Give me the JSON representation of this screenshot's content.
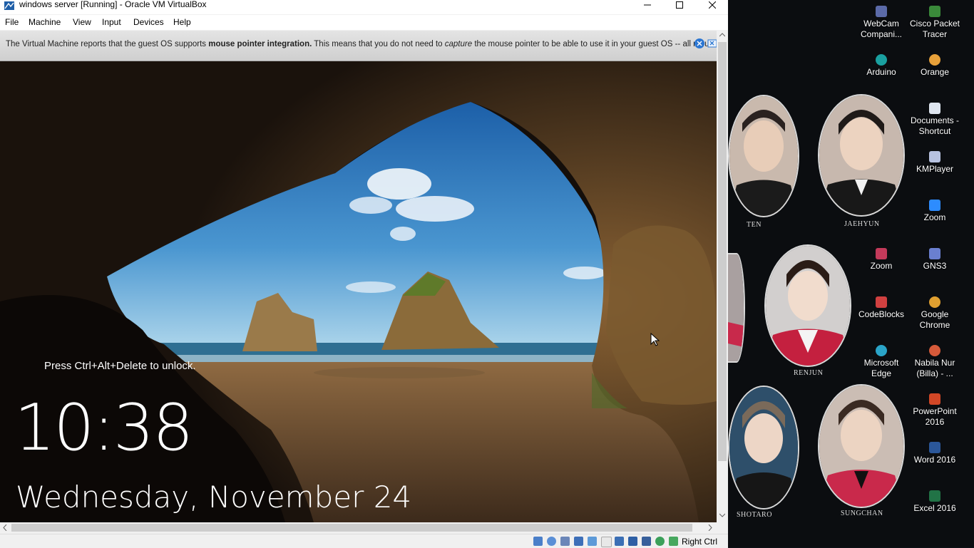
{
  "window": {
    "title": "windows server [Running] - Oracle VM VirtualBox",
    "controls": {
      "minimize": "—",
      "maximize": "☐",
      "close": "✕"
    }
  },
  "menu": [
    "File",
    "Machine",
    "View",
    "Input",
    "Devices",
    "Help"
  ],
  "notice": {
    "part1": "The Virtual Machine reports that the guest OS supports ",
    "bold": "mouse pointer integration.",
    "part2": " This means that you do not need to ",
    "italic": "capture",
    "part3": " the mouse pointer to be able to use it in your guest OS -- all mouse"
  },
  "lockscreen": {
    "unlock_text": "Press Ctrl+Alt+Delete to unlock.",
    "time": "10:38",
    "date": "Wednesday, November 24"
  },
  "statusbar": {
    "host_key": "Right Ctrl",
    "icons": [
      "hard-disk-icon",
      "optical-drive-icon",
      "audio-icon",
      "network-icon",
      "usb-icon",
      "shared-folders-icon",
      "display-icon",
      "video-capture-icon",
      "recording-icon",
      "cpu-icon",
      "mouse-integration-icon",
      "keyboard-icon"
    ]
  },
  "desktop": {
    "portraits": [
      "TEN",
      "JAEHYUN",
      "RENJUN",
      "SHOTARO",
      "SUNGCHAN"
    ],
    "icons": [
      {
        "label": "WebCam Compani...",
        "icon": "webcam-icon",
        "color": "#5b6aa8"
      },
      {
        "label": "Cisco Packet Tracer",
        "icon": "cisco-packet-tracer-icon",
        "color": "#3a8a3a"
      },
      {
        "label": "Arduino",
        "icon": "arduino-icon",
        "color": "#1aa0a0"
      },
      {
        "label": "Orange",
        "icon": "orange-icon",
        "color": "#e8a13a"
      },
      {
        "label": "Documents - Shortcut",
        "icon": "documents-icon",
        "color": "#dfe6f0"
      },
      {
        "label": "KMPlayer",
        "icon": "kmplayer-icon",
        "color": "#b7c2e0"
      },
      {
        "label": "Zoom",
        "icon": "zoom-icon",
        "color": "#2d8cff"
      },
      {
        "label": "Zoom",
        "icon": "zoom-installer-icon",
        "color": "#c33a5a"
      },
      {
        "label": "GNS3",
        "icon": "gns3-icon",
        "color": "#6a7fd0"
      },
      {
        "label": "CodeBlocks",
        "icon": "codeblocks-icon",
        "color": "#d04040"
      },
      {
        "label": "Google Chrome",
        "icon": "chrome-icon",
        "color": "#e0a030"
      },
      {
        "label": "Microsoft Edge",
        "icon": "edge-icon",
        "color": "#2aa4c8"
      },
      {
        "label": "Nabila Nur (Billa) - ...",
        "icon": "profile-icon",
        "color": "#d65a3a"
      },
      {
        "label": "PowerPoint 2016",
        "icon": "powerpoint-icon",
        "color": "#d24726"
      },
      {
        "label": "Word 2016",
        "icon": "word-icon",
        "color": "#2b579a"
      },
      {
        "label": "Excel 2016",
        "icon": "excel-icon",
        "color": "#217346"
      }
    ]
  }
}
